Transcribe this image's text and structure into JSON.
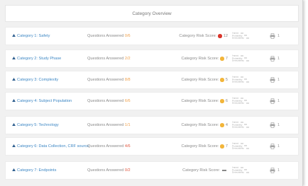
{
  "header": {
    "title": "Category Overview"
  },
  "legend": {
    "impact": "Impact",
    "probability": "Probability",
    "detectability": "Detectability"
  },
  "colors": {
    "red": "#d9352b",
    "orange": "#f2b53a",
    "link": "#3d87c4"
  },
  "rows": [
    {
      "category": "Category 1: Safety",
      "questions_label": "Questions Answered",
      "answered": "0/6",
      "risk_label": "Category Risk Score:",
      "score": "12",
      "indicator": "red-dot",
      "print_count": "1"
    },
    {
      "category": "Category 2: Study Phase",
      "questions_label": "Questions Answered",
      "answered": "2/2",
      "risk_label": "Category Risk Score:",
      "score": "7",
      "indicator": "orange-dot",
      "print_count": "1"
    },
    {
      "category": "Category 3: Complexity",
      "questions_label": "Questions Answered",
      "answered": "8/8",
      "risk_label": "Category Risk Score:",
      "score": "5",
      "indicator": "orange-dot",
      "print_count": "1"
    },
    {
      "category": "Category 4: Subject Population",
      "questions_label": "Questions Answered",
      "answered": "6/6",
      "risk_label": "Category Risk Score:",
      "score": "6",
      "indicator": "orange-dot",
      "print_count": "1"
    },
    {
      "category": "Category 5: Technology",
      "questions_label": "Questions Answered",
      "answered": "1/1",
      "risk_label": "Category Risk Score:",
      "score": "4",
      "indicator": "orange-dot",
      "print_count": "1"
    },
    {
      "category": "Category 6: Data Collection, CRF source",
      "questions_label": "Questions Answered",
      "answered": "4/6",
      "risk_label": "Category Risk Score:",
      "score": "7",
      "indicator": "orange-dot",
      "print_count": "1"
    },
    {
      "category": "Category 7: Endpoints",
      "questions_label": "Questions Answered",
      "answered": "0/2",
      "risk_label": "Category Risk Score:",
      "score": "",
      "indicator": "dash",
      "print_count": "1"
    }
  ]
}
